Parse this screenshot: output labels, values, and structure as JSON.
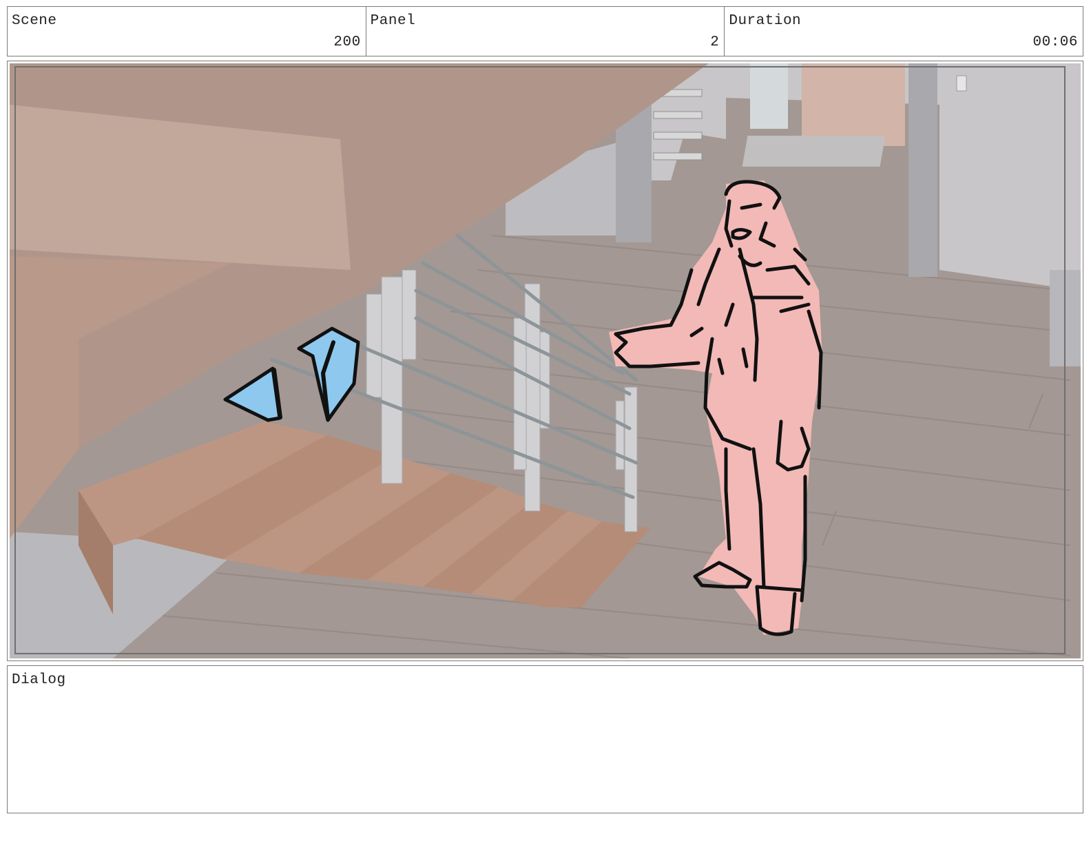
{
  "header": {
    "scene_label": "Scene",
    "scene_value": "200",
    "panel_label": "Panel",
    "panel_value": "2",
    "duration_label": "Duration",
    "duration_value": "00:06"
  },
  "dialog": {
    "label": "Dialog",
    "text": ""
  },
  "colors": {
    "frame_border": "#7a7a7a",
    "floor": "#a39893",
    "wall": "#c8c6c8",
    "stairs": "#b58c77",
    "character_fill": "#f2b9b7",
    "accent_blue": "#8ec8ee",
    "ink": "#111111"
  }
}
